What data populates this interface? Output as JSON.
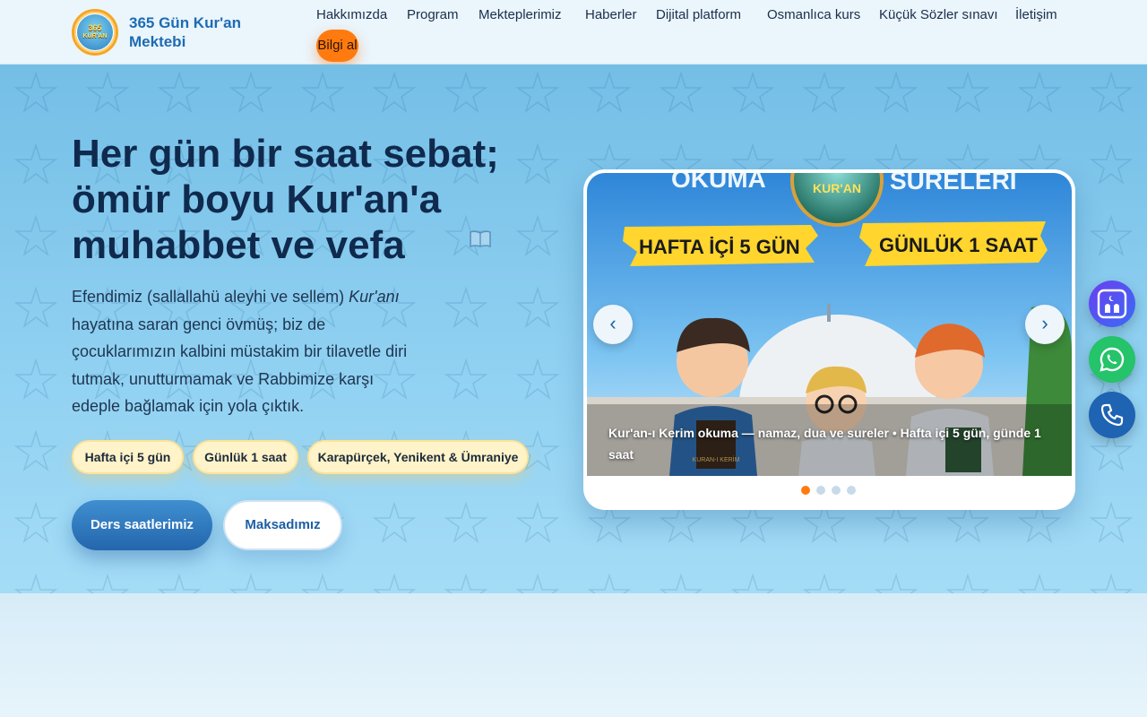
{
  "brand": {
    "name": "365 Gün Kur'an Mektebi",
    "logo_text_top": "365",
    "logo_text_mid": "KUR'AN",
    "logo_text_bottom": "MEKTEBİ"
  },
  "nav": {
    "items": [
      "Hakkımızda",
      "Program",
      "Mekteplerimiz",
      "Haberler",
      "Dijital platform",
      "Osmanlıca kurs",
      "Küçük Sözler sınavı",
      "İletişim"
    ],
    "cta": "Bilgi al"
  },
  "hero": {
    "headline": "Her gün bir saat sebat; ömür boyu Kur'an'a muhabbet ve vefa",
    "lead_prefix": "Efendimiz (sallallahü aleyhi ve sellem) ",
    "lead_em": "Kur'anı",
    "lead_suffix": " hayatına saran genci övmüş; biz de çocuklarımızın kalbini müstakim bir tilavetle diri tutmak, unutturmamak ve Rabbimize karşı edeple bağlamak için yola çıktık.",
    "chips": [
      "Hafta içi 5 gün",
      "Günlük 1 saat",
      "Karapürçek, Yenikent & Ümraniye"
    ],
    "primary_button": "Ders saatlerimiz",
    "secondary_button": "Maksadımız"
  },
  "carousel": {
    "slide_text_left": "OKUMA",
    "slide_text_right": "SURELERI",
    "slide_badge": "KUR'AN",
    "banner_left": "HAFTA İÇİ 5 GÜN",
    "banner_right": "GÜNLÜK 1 SAAT",
    "book_label": "KURAN-I KERİM",
    "caption": "Kur'an-ı Kerim okuma — namaz, dua ve sureler • Hafta içi 5 gün, günde 1 saat",
    "prev_icon": "‹",
    "next_icon": "›",
    "dot_count": 4,
    "active_dot": 0
  },
  "floating": [
    "prayer-times-icon",
    "whatsapp-icon",
    "phone-icon"
  ],
  "colors": {
    "accent_orange": "#ff7b10",
    "brand_blue": "#1d6bb3",
    "headline": "#0f2a4d",
    "chip_bg": "#fff3c9",
    "whatsapp": "#25c36a"
  }
}
